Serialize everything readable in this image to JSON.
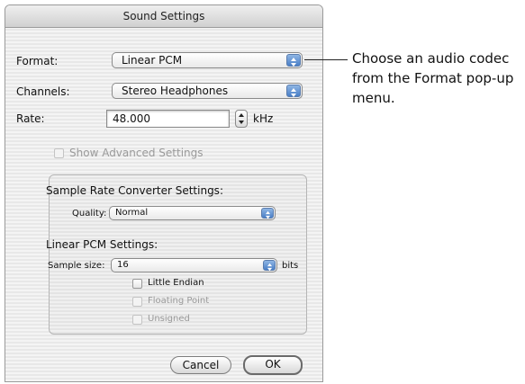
{
  "window": {
    "title": "Sound Settings"
  },
  "format": {
    "label": "Format:",
    "value": "Linear PCM"
  },
  "channels": {
    "label": "Channels:",
    "value": "Stereo Headphones"
  },
  "rate": {
    "label": "Rate:",
    "value": "48.000",
    "unit": "kHz"
  },
  "advanced": {
    "label": "Show Advanced Settings",
    "enabled": false
  },
  "sample_rate_converter": {
    "heading": "Sample Rate Converter Settings:",
    "quality_label": "Quality:",
    "quality_value": "Normal"
  },
  "linear_pcm": {
    "heading": "Linear PCM Settings:",
    "sample_size_label": "Sample size:",
    "sample_size_value": "16",
    "sample_size_unit": "bits",
    "options": [
      {
        "label": "Little Endian",
        "enabled": true
      },
      {
        "label": "Floating Point",
        "enabled": false
      },
      {
        "label": "Unsigned",
        "enabled": false
      }
    ]
  },
  "buttons": {
    "cancel": "Cancel",
    "ok": "OK"
  },
  "callout": {
    "text": "Choose an audio codec from the Format pop-up menu."
  },
  "colors": {
    "stepper_blue": "#4a7fc7",
    "window_bg": "#f4f4f4"
  }
}
